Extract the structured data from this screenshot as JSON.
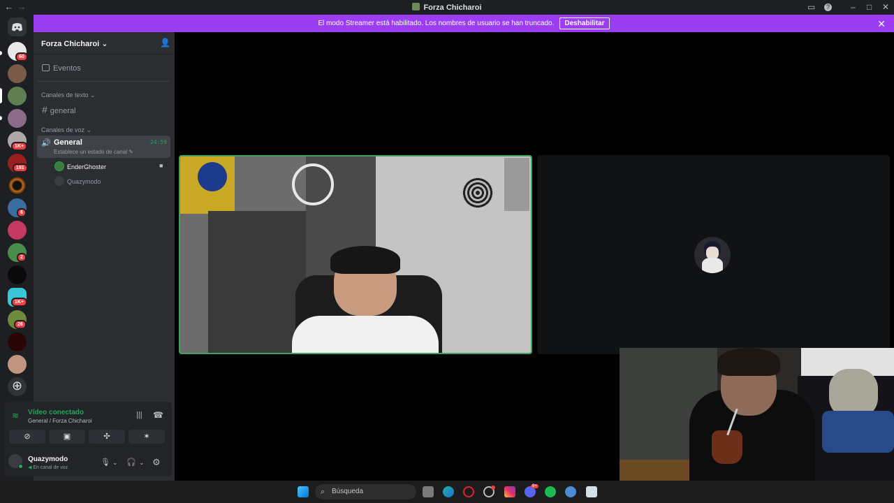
{
  "window": {
    "title": "Forza Chicharoi"
  },
  "banner": {
    "message": "El modo Streamer está habilitado. Los nombres de usuario se han truncado.",
    "disable_label": "Deshabilitar"
  },
  "rail": {
    "badges": [
      "60",
      "1K+",
      "191",
      "6",
      "2",
      "1K+",
      "26"
    ]
  },
  "server": {
    "name": "Forza Chicharoi",
    "events_label": "Eventos",
    "text_category": "Canales de texto",
    "text_channel": "general",
    "voice_category": "Canales de voz",
    "voice_channel": {
      "name": "General",
      "timer": "24:59",
      "status_hint": "Establece un estado de canal"
    },
    "members": [
      "EnderGhoster",
      "Quazymodo"
    ]
  },
  "voice_panel": {
    "status": "Vídeo conectado",
    "location": "General / Forza Chicharoi"
  },
  "user": {
    "name": "Quazymodo",
    "status": "En canal de voz"
  },
  "taskbar": {
    "search_placeholder": "Búsqueda",
    "spotify_badge": "9+"
  },
  "colors": {
    "accent_green": "#3ba55c",
    "streamer_purple": "#9b3ef2",
    "mention_red": "#f23f43"
  }
}
